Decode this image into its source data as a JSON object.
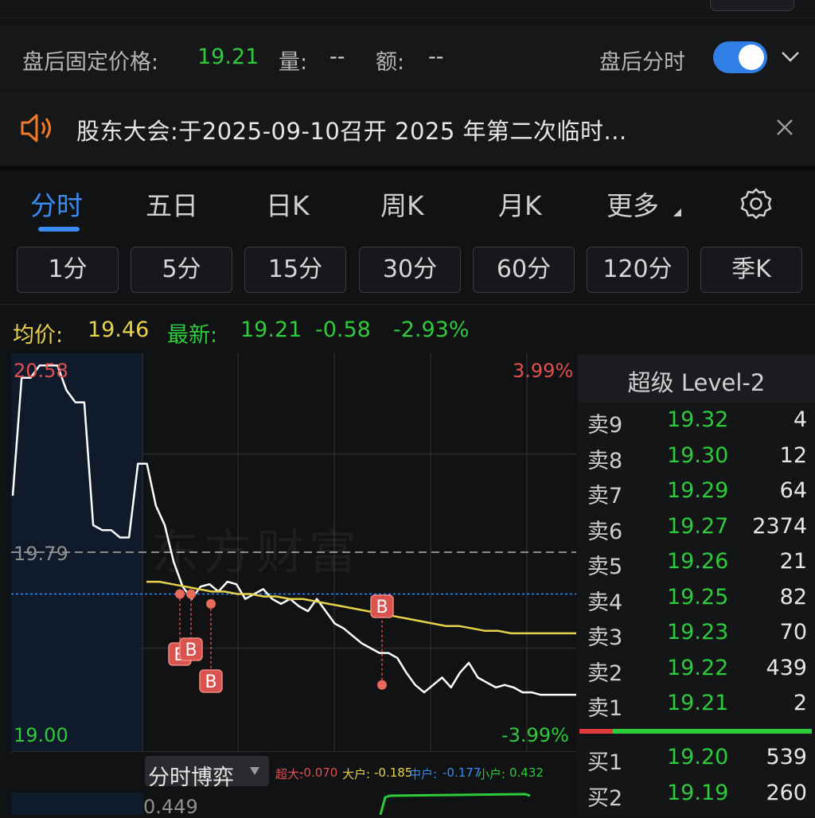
{
  "after_hours": {
    "fixed_price_label": "盘后固定价格:",
    "fixed_price": "19.21",
    "volume_label": "量:",
    "volume": "--",
    "amount_label": "额:",
    "amount": "--",
    "switch_label": "盘后分时",
    "switch_on": true
  },
  "announcement": {
    "text": "股东大会:于2025-09-10召开 2025 年第二次临时..."
  },
  "period_tabs": [
    {
      "label": "分时",
      "active": true
    },
    {
      "label": "五日",
      "active": false
    },
    {
      "label": "日K",
      "active": false
    },
    {
      "label": "周K",
      "active": false
    },
    {
      "label": "月K",
      "active": false
    },
    {
      "label": "更多",
      "active": false
    }
  ],
  "minute_buttons": [
    "1分",
    "5分",
    "15分",
    "30分",
    "60分",
    "120分",
    "季K"
  ],
  "quote": {
    "avg_label": "均价:",
    "avg_value": "19.46",
    "last_label": "最新:",
    "last_value": "19.21",
    "change": "-0.58",
    "change_pct": "-2.93%"
  },
  "chart_labels": {
    "high": "20.58",
    "high_pct": "3.99%",
    "prev_close": "19.79",
    "low": "19.00",
    "low_pct": "-3.99%",
    "watermark": "东方财富"
  },
  "chart_data": {
    "type": "line",
    "ylim": [
      19.0,
      20.58
    ],
    "prev_close": 19.79,
    "series": [
      {
        "values": [
          20.02,
          20.5,
          20.5,
          20.55,
          20.55,
          20.55,
          20.45,
          20.4,
          20.4,
          19.9,
          19.88,
          19.88,
          19.85,
          19.85,
          20.15,
          20.15,
          19.98,
          19.9,
          19.75,
          19.65,
          19.6,
          19.65,
          19.66,
          19.63,
          19.67,
          19.66,
          19.6,
          19.62,
          19.64,
          19.6,
          19.58,
          19.6,
          19.57,
          19.55,
          19.6,
          19.55,
          19.5,
          19.48,
          19.45,
          19.42,
          19.4,
          19.38,
          19.38,
          19.36,
          19.3,
          19.25,
          19.22,
          19.25,
          19.28,
          19.24,
          19.3,
          19.34,
          19.28,
          19.26,
          19.24,
          19.25,
          19.24,
          19.22,
          19.22,
          19.21,
          19.21,
          19.21,
          19.21,
          19.21
        ]
      },
      {
        "values": [
          19.67,
          19.67,
          19.66,
          19.65,
          19.64,
          19.63,
          19.63,
          19.62,
          19.62,
          19.61,
          19.61,
          19.6,
          19.6,
          19.59,
          19.58,
          19.57,
          19.56,
          19.55,
          19.54,
          19.53,
          19.52,
          19.51,
          19.5,
          19.49,
          19.49,
          19.48,
          19.47,
          19.47,
          19.46,
          19.46,
          19.46,
          19.46,
          19.46,
          19.46
        ]
      }
    ],
    "trade_markers": [
      {
        "label": "B",
        "price": 19.62
      },
      {
        "label": "B",
        "price": 19.62
      },
      {
        "label": "B",
        "price": 19.58
      },
      {
        "label": "B",
        "price": 19.25
      }
    ]
  },
  "order_book": {
    "title": "超级 Level-2",
    "asks": [
      {
        "level": "卖9",
        "price": "19.32",
        "qty": "4"
      },
      {
        "level": "卖8",
        "price": "19.30",
        "qty": "12"
      },
      {
        "level": "卖7",
        "price": "19.29",
        "qty": "64"
      },
      {
        "level": "卖6",
        "price": "19.27",
        "qty": "2374"
      },
      {
        "level": "卖5",
        "price": "19.26",
        "qty": "21"
      },
      {
        "level": "卖4",
        "price": "19.25",
        "qty": "82"
      },
      {
        "level": "卖3",
        "price": "19.23",
        "qty": "70"
      },
      {
        "level": "卖2",
        "price": "19.22",
        "qty": "439"
      },
      {
        "level": "卖1",
        "price": "19.21",
        "qty": "2"
      }
    ],
    "bids": [
      {
        "level": "买1",
        "price": "19.20",
        "qty": "539"
      },
      {
        "level": "买2",
        "price": "19.19",
        "qty": "260"
      }
    ]
  },
  "indicator": {
    "name": "分时博弈",
    "super_label": "超大:",
    "super_value": "-0.070",
    "large_label": "大户:",
    "large_value": "-0.185",
    "medium_label": "中户:",
    "medium_value": "-0.177",
    "small_label": "小户:",
    "small_value": "0.432",
    "axis_value": "0.449"
  },
  "colors": {
    "green": "#2ecb3b",
    "red": "#e05050",
    "yellow": "#e8d24a",
    "blue": "#3c8bf0"
  }
}
